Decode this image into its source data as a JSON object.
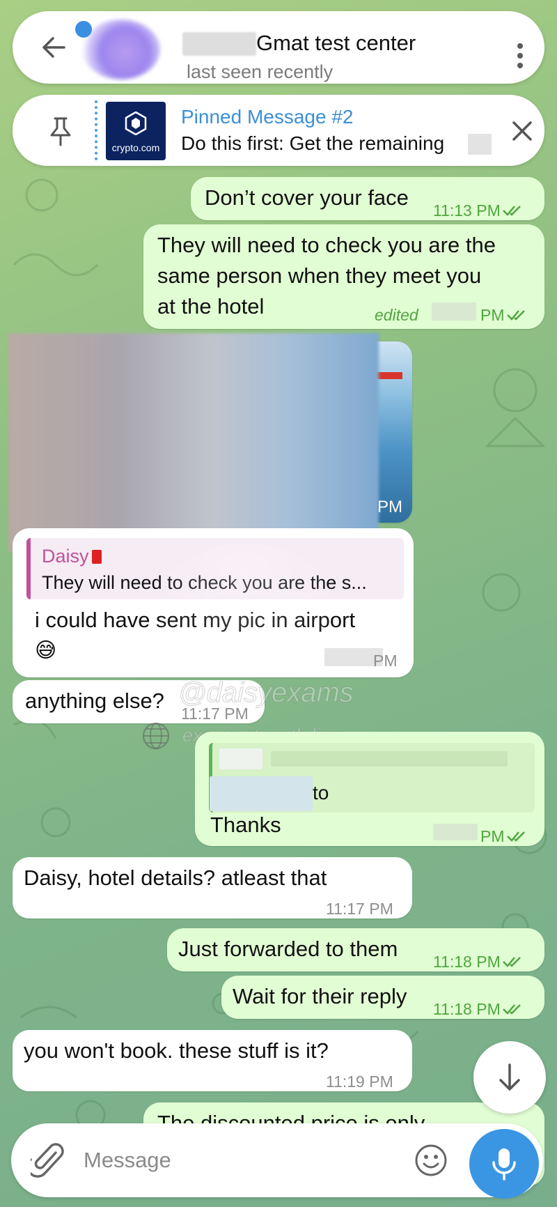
{
  "header": {
    "title": "Gmat test center",
    "status": "last seen recently",
    "back_icon": "arrow-left-icon",
    "menu_icon": "more-vertical-icon"
  },
  "pinned": {
    "title": "Pinned Message #2",
    "text": "Do this first: Get the remaining",
    "thumb_brand": "crypto.com"
  },
  "messages": [
    {
      "dir": "out",
      "text": "Don’t cover your face",
      "time": "11:13 PM",
      "read": true
    },
    {
      "dir": "out",
      "lines": [
        "They will need to check you are the",
        "same person when they meet you",
        "at the hotel"
      ],
      "edited": "edited",
      "time": "PM",
      "read": true
    },
    {
      "dir": "out",
      "type": "photo",
      "time": "PM"
    },
    {
      "dir": "in",
      "reply_name": "Daisy",
      "reply_text": "They will need to check you are the s...",
      "text": "i could have sent my pic in airport",
      "emoji": "😅",
      "time": "PM"
    },
    {
      "dir": "in",
      "text": "anything else?",
      "time": "11:17 PM"
    },
    {
      "dir": "out",
      "fwd_text": "to",
      "text": "Thanks",
      "time": "PM",
      "read": true
    },
    {
      "dir": "in",
      "text": "Daisy, hotel details? atleast that",
      "time": "11:17 PM"
    },
    {
      "dir": "out",
      "text": "Just forwarded to them",
      "time": "11:18 PM",
      "read": true
    },
    {
      "dir": "out",
      "text": "Wait for their reply",
      "time": "11:18 PM",
      "read": true
    },
    {
      "dir": "in",
      "text": "you won't book. these stuff is it?",
      "time": "11:19 PM"
    },
    {
      "dir": "out",
      "text": "The discounted price is only"
    }
  ],
  "watermark": {
    "handle": "@daisyexams",
    "site": "examinator.eth.limo"
  },
  "composer": {
    "placeholder": "Message",
    "attach_icon": "paperclip-icon",
    "emoji_icon": "smiley-icon",
    "mic_icon": "microphone-icon"
  },
  "colors": {
    "outgoing_bubble": "#e1fdd3",
    "incoming_bubble": "#ffffff",
    "accent": "#3a96e3",
    "outgoing_time": "#4fa63f",
    "reply_accent": "#c1519a"
  }
}
